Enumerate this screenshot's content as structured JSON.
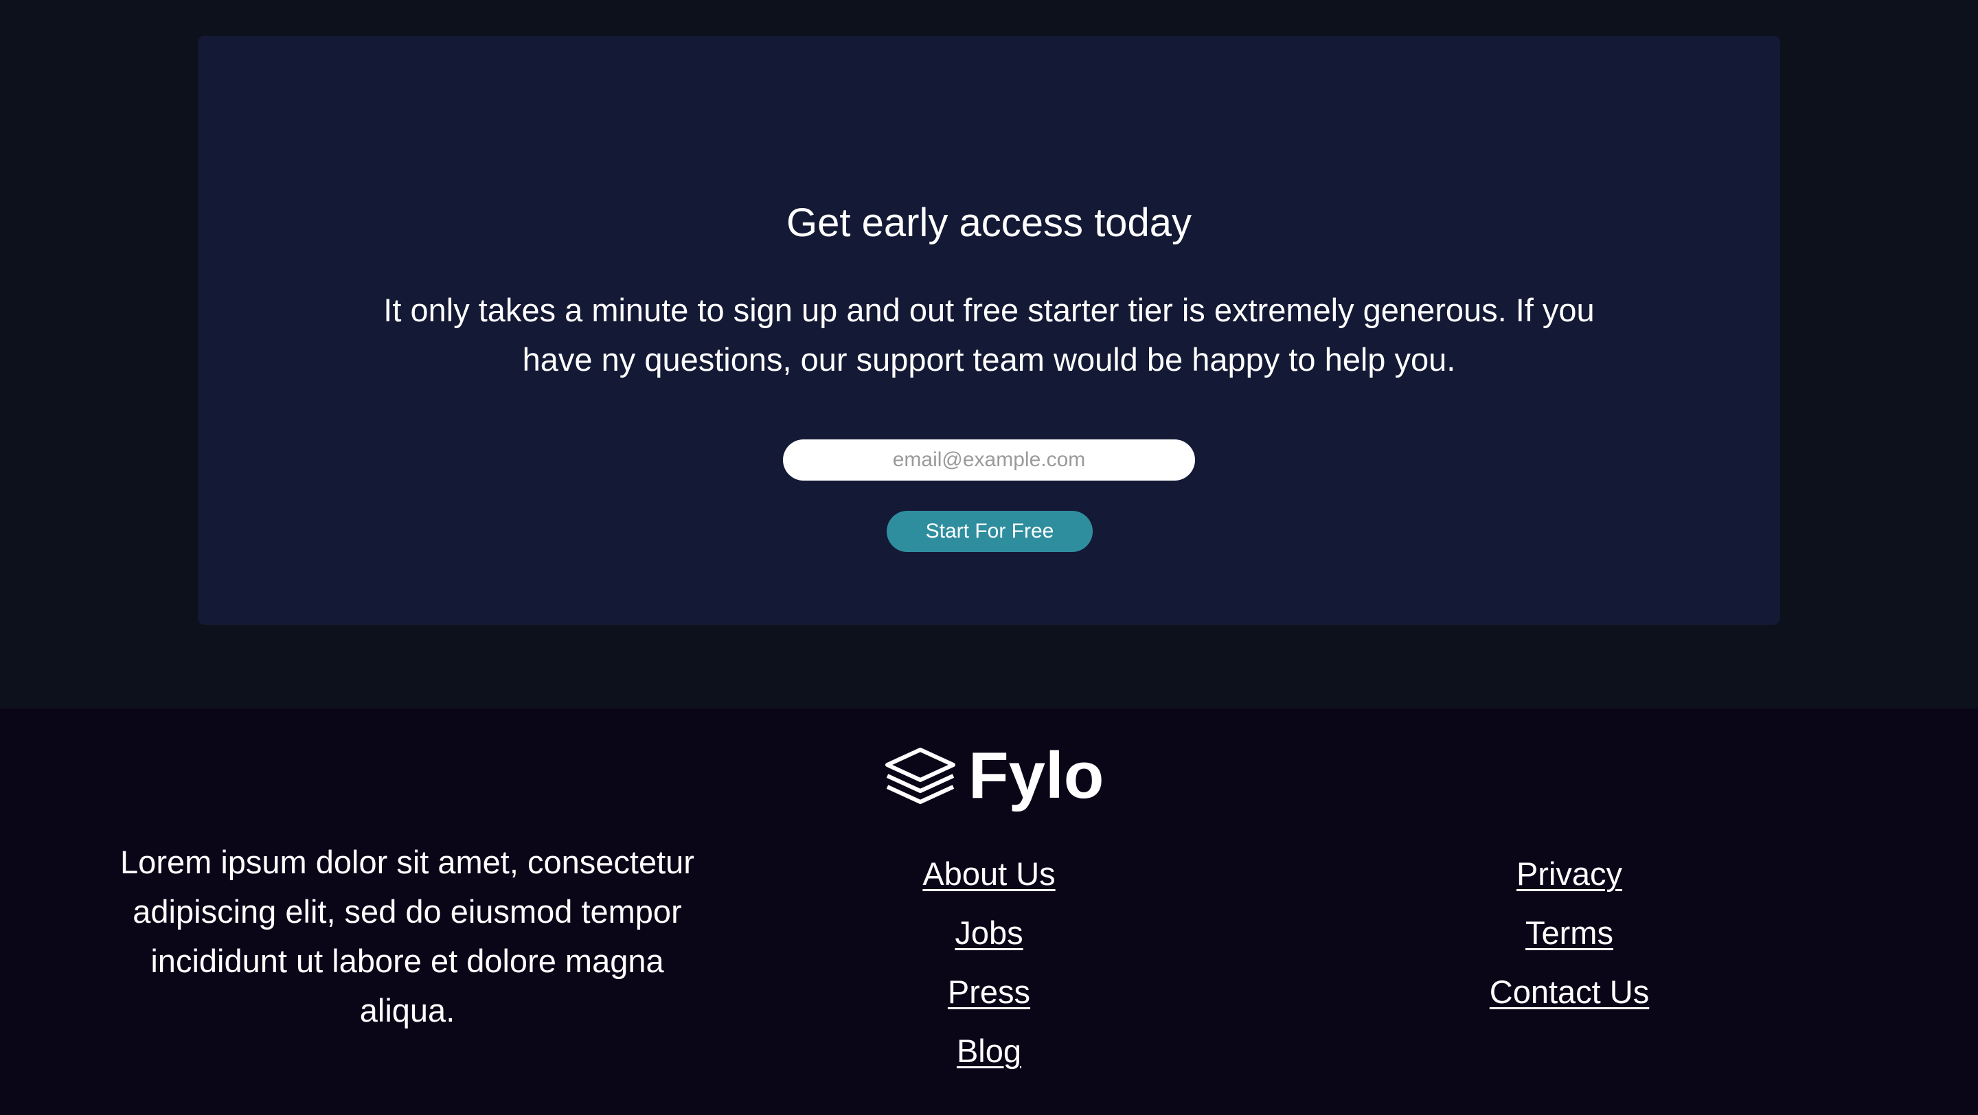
{
  "cta": {
    "title": "Get early access today",
    "text": "It only takes a minute to sign up and out free starter tier is extremely generous. If you have ny questions, our support team would be happy to help you.",
    "email_placeholder": "email@example.com",
    "email_value": "",
    "button_label": "Start For Free",
    "button_color": "#2f8e9e"
  },
  "footer": {
    "logo_icon": "layers-stack-icon",
    "brand_name": "Fylo",
    "description": "Lorem ipsum dolor sit amet, consectetur adipiscing elit, sed do eiusmod tempor incididunt ut labore et dolore magna aliqua.",
    "links_col_a": [
      "About Us",
      "Jobs",
      "Press",
      "Blog"
    ],
    "links_col_b": [
      "Privacy",
      "Terms",
      "Contact Us"
    ]
  },
  "colors": {
    "page_background": "#0d111c",
    "card_background": "#141935",
    "footer_background": "#0b0518",
    "text": "#ffffff"
  }
}
